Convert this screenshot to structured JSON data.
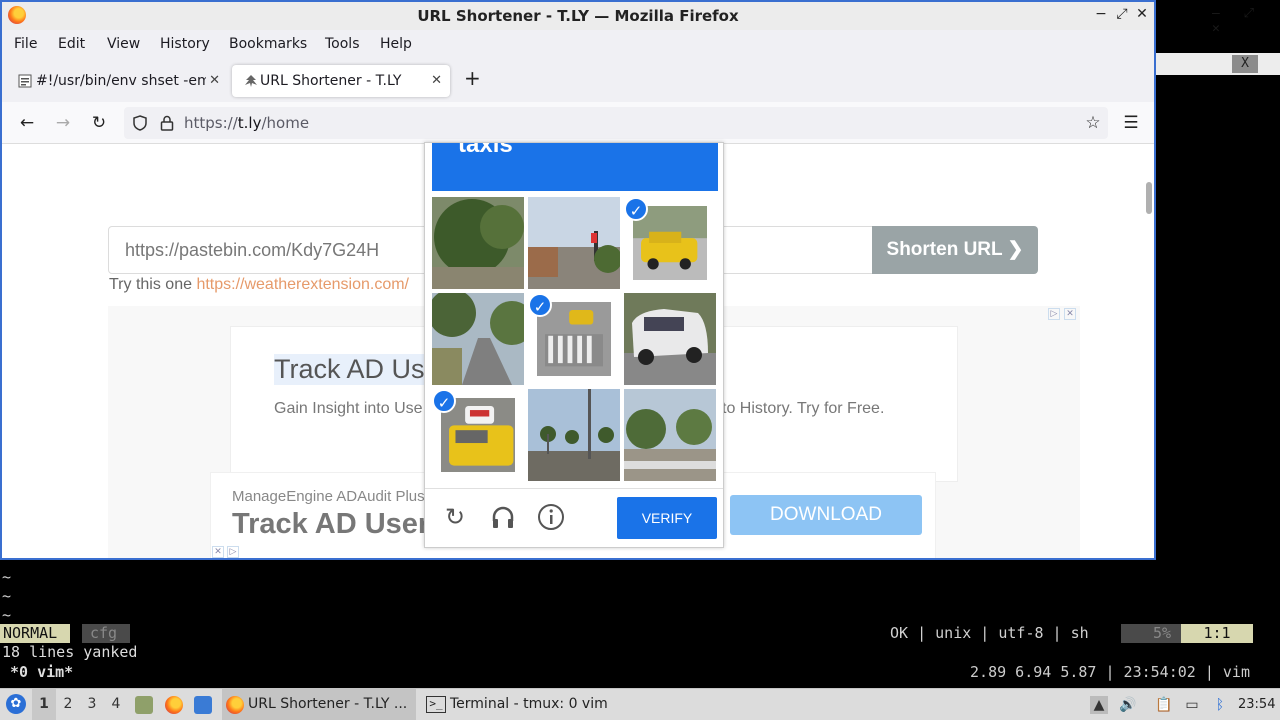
{
  "terminal": {
    "tilde_lines": [
      "~",
      "~",
      "~"
    ],
    "mode": "NORMAL",
    "filetype_tag": "cfg",
    "status_right": "OK | unix | utf-8 | sh",
    "percent": "5%",
    "position": "1:1",
    "message": "18 lines yanked",
    "tmux_window": "*0 vim*",
    "tmux_right": "2.89 6.94 5.87 | 23:54:02 | vim",
    "side_close": "X"
  },
  "firefox": {
    "window_title": "URL Shortener - T.LY — Mozilla Firefox",
    "controls": {
      "minimize": "−",
      "maximize": "⤢",
      "close": "✕"
    },
    "menu": [
      "File",
      "Edit",
      "View",
      "History",
      "Bookmarks",
      "Tools",
      "Help"
    ],
    "tabs": [
      {
        "label": "#!/usr/bin/env shset -em",
        "close": "✕"
      },
      {
        "label": "URL Shortener - T.LY",
        "close": "✕"
      }
    ],
    "new_tab": "+",
    "url": {
      "prefix": "https://",
      "host": "t.ly",
      "path": "/home"
    }
  },
  "page": {
    "input_value": "https://pastebin.com/Kdy7G24H",
    "shorten_label": "Shorten URL ❯",
    "try_prefix": "Try this one ",
    "try_link": "https://weatherextension.com/",
    "ad_title": "Track AD Us",
    "ad_desc": "Gain Insight into Use",
    "ad_desc_tail": "to History. Try for Free.",
    "ad2_sub": "ManageEngine ADAudit Plus",
    "ad2_title": "Track AD User",
    "download_label": "DOWNLOAD"
  },
  "captcha": {
    "header": "taxis",
    "selected_tiles": [
      3,
      5,
      7
    ],
    "verify_label": "VERIFY",
    "icons": [
      "reload-icon",
      "audio-icon",
      "info-icon"
    ]
  },
  "taskbar": {
    "workspaces": [
      "1",
      "2",
      "3",
      "4"
    ],
    "active_workspace": "1",
    "tasks": [
      {
        "label": "URL Shortener - T.LY ..."
      },
      {
        "label": "Terminal - tmux: 0 vim"
      }
    ],
    "clock": "23:54"
  }
}
